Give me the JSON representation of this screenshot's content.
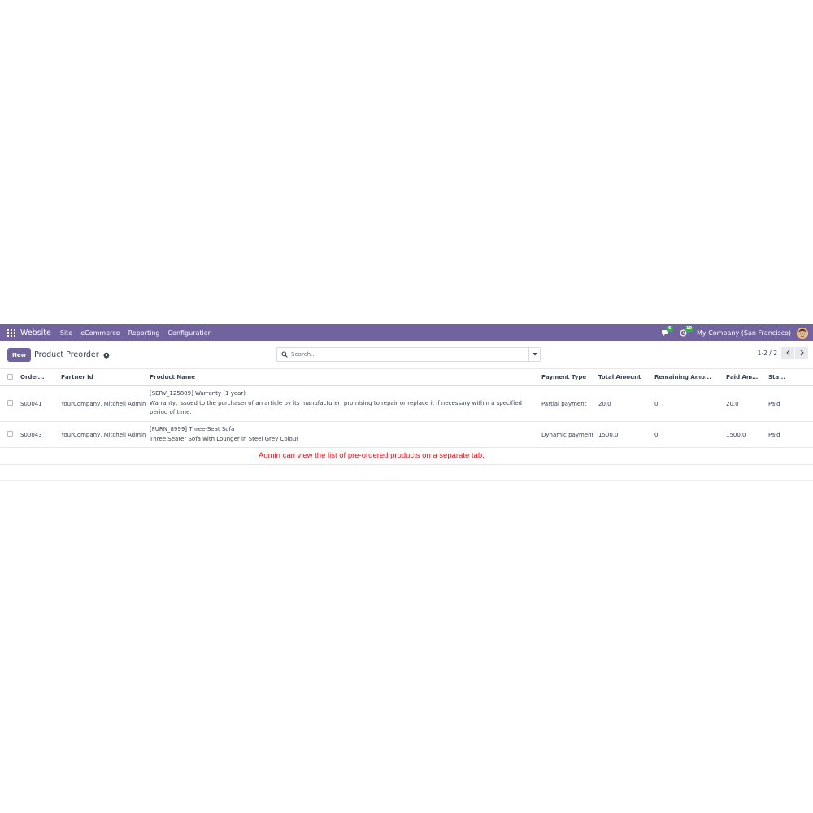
{
  "navbar": {
    "app_name": "Website",
    "menus": [
      "Site",
      "eCommerce",
      "Reporting",
      "Configuration"
    ],
    "messages_count": "6",
    "activity_count": "10",
    "company": "My Company (San Francisco)"
  },
  "control_panel": {
    "new_label": "New",
    "title": "Product Preorder",
    "search_placeholder": "Search...",
    "pager": "1-2 / 2"
  },
  "table": {
    "columns": [
      "Order...",
      "Partner Id",
      "Product Name",
      "Payment Type",
      "Total Amount",
      "Remaining Amo...",
      "Paid Amount",
      "Sta..."
    ],
    "rows": [
      {
        "order": "S00041",
        "partner": "YourCompany, Mitchell Admin",
        "product_line1": "[SERV_125889] Warranty (1 year)",
        "product_line2": "Warranty, issued to the purchaser of an article by its manufacturer, promising to repair or replace it if necessary within a specified period of time.",
        "payment_type": "Partial payment",
        "total": "20.0",
        "remaining": "0",
        "paid": "20.0",
        "state": "Paid"
      },
      {
        "order": "S00043",
        "partner": "YourCompany, Mitchell Admin",
        "product_line1": "[FURN_8999] Three-Seat Sofa",
        "product_line2": "Three Seater Sofa with Lounger in Steel Grey Colour",
        "payment_type": "Dynamic payment",
        "total": "1500.0",
        "remaining": "0",
        "paid": "1500.0",
        "state": "Paid"
      }
    ]
  },
  "annotation": "Admin can view the list of pre-ordered products on a separate tab.",
  "colors": {
    "brand": "#71639e",
    "annotation": "#e0161b",
    "badge": "#2fb344"
  }
}
